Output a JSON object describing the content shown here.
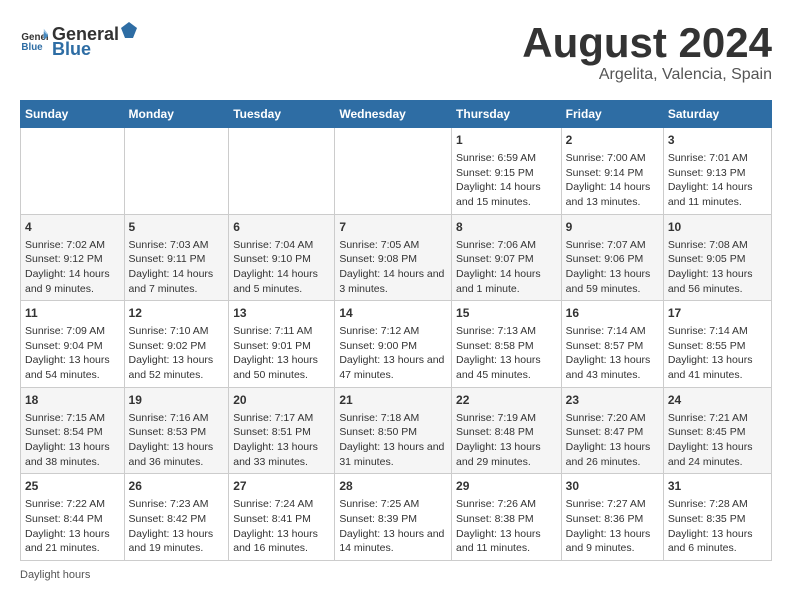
{
  "header": {
    "logo_general": "General",
    "logo_blue": "Blue",
    "main_title": "August 2024",
    "subtitle": "Argelita, Valencia, Spain"
  },
  "calendar": {
    "days_of_week": [
      "Sunday",
      "Monday",
      "Tuesday",
      "Wednesday",
      "Thursday",
      "Friday",
      "Saturday"
    ],
    "weeks": [
      [
        {
          "day": "",
          "content": ""
        },
        {
          "day": "",
          "content": ""
        },
        {
          "day": "",
          "content": ""
        },
        {
          "day": "",
          "content": ""
        },
        {
          "day": "1",
          "content": "Sunrise: 6:59 AM\nSunset: 9:15 PM\nDaylight: 14 hours and 15 minutes."
        },
        {
          "day": "2",
          "content": "Sunrise: 7:00 AM\nSunset: 9:14 PM\nDaylight: 14 hours and 13 minutes."
        },
        {
          "day": "3",
          "content": "Sunrise: 7:01 AM\nSunset: 9:13 PM\nDaylight: 14 hours and 11 minutes."
        }
      ],
      [
        {
          "day": "4",
          "content": "Sunrise: 7:02 AM\nSunset: 9:12 PM\nDaylight: 14 hours and 9 minutes."
        },
        {
          "day": "5",
          "content": "Sunrise: 7:03 AM\nSunset: 9:11 PM\nDaylight: 14 hours and 7 minutes."
        },
        {
          "day": "6",
          "content": "Sunrise: 7:04 AM\nSunset: 9:10 PM\nDaylight: 14 hours and 5 minutes."
        },
        {
          "day": "7",
          "content": "Sunrise: 7:05 AM\nSunset: 9:08 PM\nDaylight: 14 hours and 3 minutes."
        },
        {
          "day": "8",
          "content": "Sunrise: 7:06 AM\nSunset: 9:07 PM\nDaylight: 14 hours and 1 minute."
        },
        {
          "day": "9",
          "content": "Sunrise: 7:07 AM\nSunset: 9:06 PM\nDaylight: 13 hours and 59 minutes."
        },
        {
          "day": "10",
          "content": "Sunrise: 7:08 AM\nSunset: 9:05 PM\nDaylight: 13 hours and 56 minutes."
        }
      ],
      [
        {
          "day": "11",
          "content": "Sunrise: 7:09 AM\nSunset: 9:04 PM\nDaylight: 13 hours and 54 minutes."
        },
        {
          "day": "12",
          "content": "Sunrise: 7:10 AM\nSunset: 9:02 PM\nDaylight: 13 hours and 52 minutes."
        },
        {
          "day": "13",
          "content": "Sunrise: 7:11 AM\nSunset: 9:01 PM\nDaylight: 13 hours and 50 minutes."
        },
        {
          "day": "14",
          "content": "Sunrise: 7:12 AM\nSunset: 9:00 PM\nDaylight: 13 hours and 47 minutes."
        },
        {
          "day": "15",
          "content": "Sunrise: 7:13 AM\nSunset: 8:58 PM\nDaylight: 13 hours and 45 minutes."
        },
        {
          "day": "16",
          "content": "Sunrise: 7:14 AM\nSunset: 8:57 PM\nDaylight: 13 hours and 43 minutes."
        },
        {
          "day": "17",
          "content": "Sunrise: 7:14 AM\nSunset: 8:55 PM\nDaylight: 13 hours and 41 minutes."
        }
      ],
      [
        {
          "day": "18",
          "content": "Sunrise: 7:15 AM\nSunset: 8:54 PM\nDaylight: 13 hours and 38 minutes."
        },
        {
          "day": "19",
          "content": "Sunrise: 7:16 AM\nSunset: 8:53 PM\nDaylight: 13 hours and 36 minutes."
        },
        {
          "day": "20",
          "content": "Sunrise: 7:17 AM\nSunset: 8:51 PM\nDaylight: 13 hours and 33 minutes."
        },
        {
          "day": "21",
          "content": "Sunrise: 7:18 AM\nSunset: 8:50 PM\nDaylight: 13 hours and 31 minutes."
        },
        {
          "day": "22",
          "content": "Sunrise: 7:19 AM\nSunset: 8:48 PM\nDaylight: 13 hours and 29 minutes."
        },
        {
          "day": "23",
          "content": "Sunrise: 7:20 AM\nSunset: 8:47 PM\nDaylight: 13 hours and 26 minutes."
        },
        {
          "day": "24",
          "content": "Sunrise: 7:21 AM\nSunset: 8:45 PM\nDaylight: 13 hours and 24 minutes."
        }
      ],
      [
        {
          "day": "25",
          "content": "Sunrise: 7:22 AM\nSunset: 8:44 PM\nDaylight: 13 hours and 21 minutes."
        },
        {
          "day": "26",
          "content": "Sunrise: 7:23 AM\nSunset: 8:42 PM\nDaylight: 13 hours and 19 minutes."
        },
        {
          "day": "27",
          "content": "Sunrise: 7:24 AM\nSunset: 8:41 PM\nDaylight: 13 hours and 16 minutes."
        },
        {
          "day": "28",
          "content": "Sunrise: 7:25 AM\nSunset: 8:39 PM\nDaylight: 13 hours and 14 minutes."
        },
        {
          "day": "29",
          "content": "Sunrise: 7:26 AM\nSunset: 8:38 PM\nDaylight: 13 hours and 11 minutes."
        },
        {
          "day": "30",
          "content": "Sunrise: 7:27 AM\nSunset: 8:36 PM\nDaylight: 13 hours and 9 minutes."
        },
        {
          "day": "31",
          "content": "Sunrise: 7:28 AM\nSunset: 8:35 PM\nDaylight: 13 hours and 6 minutes."
        }
      ]
    ]
  },
  "footer": {
    "note": "Daylight hours"
  }
}
